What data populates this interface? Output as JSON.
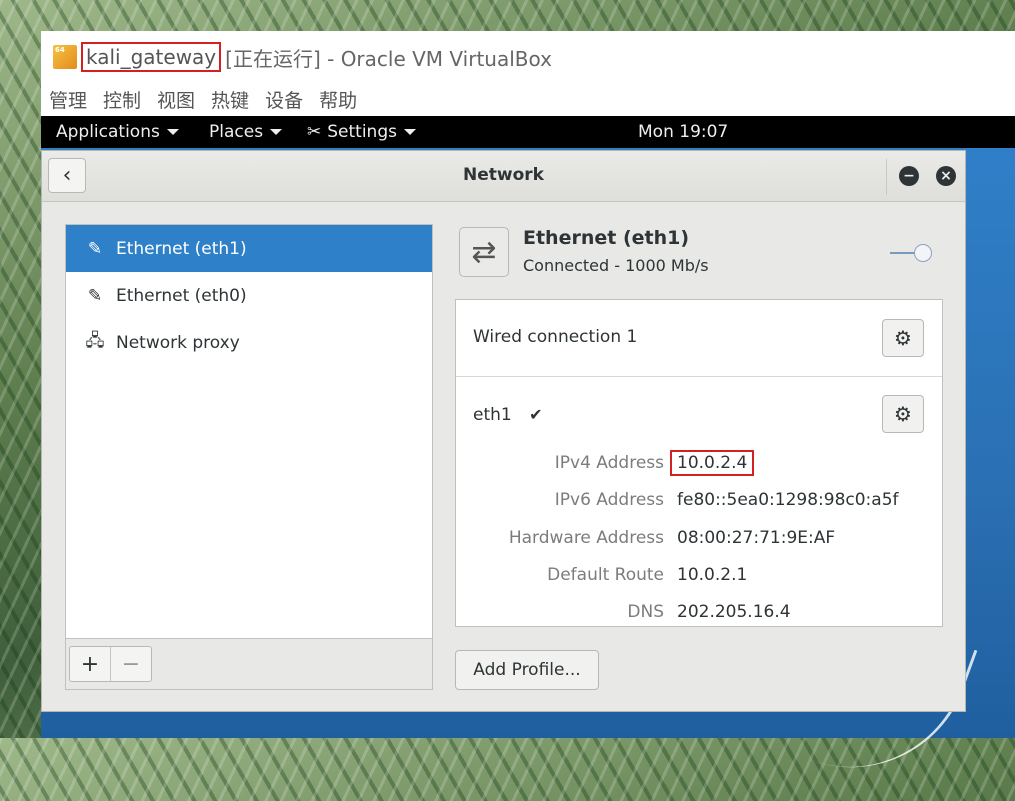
{
  "vbox": {
    "vm_name": "kali_gateway",
    "title_rest": "[正在运行] - Oracle VM VirtualBox",
    "menu": [
      "管理",
      "控制",
      "视图",
      "热键",
      "设备",
      "帮助"
    ]
  },
  "topbar": {
    "applications": "Applications",
    "places": "Places",
    "settings": "Settings",
    "clock": "Mon 19:07"
  },
  "window": {
    "title": "Network",
    "back_glyph": "‹",
    "minimize_glyph": "−",
    "close_glyph": "×"
  },
  "devices": [
    {
      "label": "Ethernet (eth1)",
      "icon": "ethernet-icon",
      "selected": true
    },
    {
      "label": "Ethernet (eth0)",
      "icon": "ethernet-icon",
      "selected": false
    },
    {
      "label": "Network proxy",
      "icon": "network-proxy-icon",
      "selected": false
    }
  ],
  "list_footer": {
    "add": "+",
    "remove": "−"
  },
  "device_panel": {
    "name": "Ethernet (eth1)",
    "status": "Connected - 1000 Mb/s",
    "toggle_on": true,
    "profile_name": "Wired connection 1",
    "interface": "eth1",
    "details": [
      {
        "key": "IPv4 Address",
        "value": "10.0.2.4",
        "highlight": true
      },
      {
        "key": "IPv6 Address",
        "value": "fe80::5ea0:1298:98c0:a5f"
      },
      {
        "key": "Hardware Address",
        "value": "08:00:27:71:9E:AF"
      },
      {
        "key": "Default Route",
        "value": "10.0.2.1"
      },
      {
        "key": "DNS",
        "value": "202.205.16.4"
      }
    ],
    "add_profile": "Add Profile..."
  },
  "colors": {
    "selection": "#2e80c8",
    "highlight_box": "#d32020",
    "topbar": "#000000"
  }
}
